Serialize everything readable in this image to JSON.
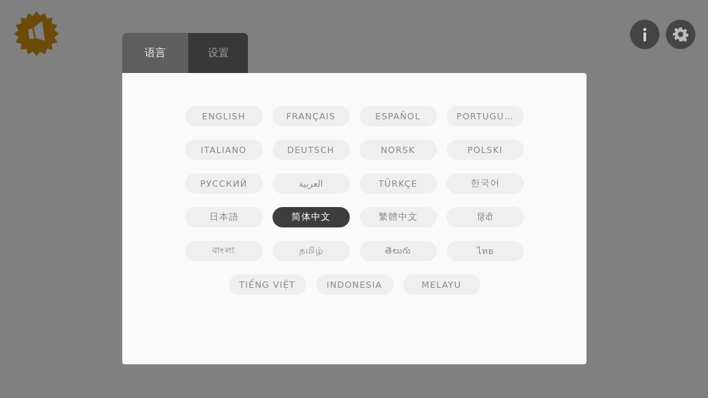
{
  "tabs": [
    {
      "label": "语言",
      "selected": true
    },
    {
      "label": "设置",
      "selected": false
    }
  ],
  "languages": [
    {
      "label": "ENGLISH",
      "selected": false
    },
    {
      "label": "FRANÇAIS",
      "selected": false
    },
    {
      "label": "ESPAÑOL",
      "selected": false
    },
    {
      "label": "PORTUGU…",
      "selected": false
    },
    {
      "label": "ITALIANO",
      "selected": false
    },
    {
      "label": "DEUTSCH",
      "selected": false
    },
    {
      "label": "NORSK",
      "selected": false
    },
    {
      "label": "POLSKI",
      "selected": false
    },
    {
      "label": "РУССКИЙ",
      "selected": false
    },
    {
      "label": "العربية",
      "selected": false
    },
    {
      "label": "TÜRKÇE",
      "selected": false
    },
    {
      "label": "한국어",
      "selected": false
    },
    {
      "label": "日本語",
      "selected": false
    },
    {
      "label": "简体中文",
      "selected": true
    },
    {
      "label": "繁體中文",
      "selected": false
    },
    {
      "label": "हिंदी",
      "selected": false
    },
    {
      "label": "বাংলা",
      "selected": false
    },
    {
      "label": "தமிழ்",
      "selected": false
    },
    {
      "label": "తెలుగు",
      "selected": false
    },
    {
      "label": "ไทย",
      "selected": false
    },
    {
      "label": "TIẾNG VIỆT",
      "selected": false
    },
    {
      "label": "INDONESIA",
      "selected": false
    },
    {
      "label": "MELAYU",
      "selected": false
    }
  ]
}
